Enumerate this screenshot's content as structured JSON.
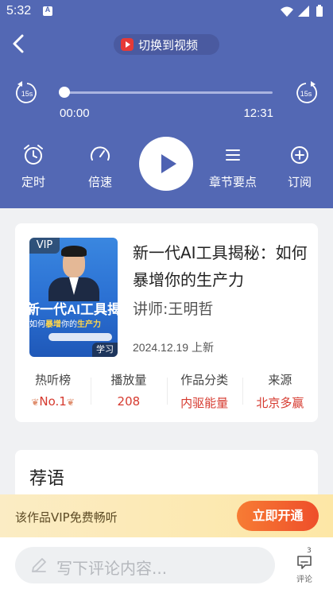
{
  "status_bar": {
    "time": "5:32",
    "notif_letter": "A"
  },
  "player": {
    "switch_label": "切换到视频",
    "skip_back_label": "15s",
    "skip_fwd_label": "15s",
    "current_time": "00:00",
    "total_time": "12:31",
    "progress": 0,
    "controls": [
      "定时",
      "倍速",
      "章节要点",
      "订阅"
    ]
  },
  "album": {
    "cover": {
      "vip": "VIP",
      "headline": "新一代AI工具揭",
      "sub_prefix": "如何",
      "sub_highlight1": "暴增",
      "sub_mid": "你的",
      "sub_highlight2": "生产力",
      "tag": "学习"
    },
    "title": "新一代AI工具揭秘：如何暴增你的生产力",
    "lecturer": "讲师:王明哲",
    "date": "2024.12.19 上新",
    "stats": [
      {
        "key": "热听榜",
        "value": "No.1"
      },
      {
        "key": "播放量",
        "value": "208"
      },
      {
        "key": "作品分类",
        "value": "内驱能量"
      },
      {
        "key": "来源",
        "value": "北京多赢"
      }
    ]
  },
  "recommend": {
    "heading": "荐语"
  },
  "vip_bar": {
    "text": "该作品VIP免费畅听",
    "button": "立即开通"
  },
  "comment": {
    "placeholder": "写下评论内容...",
    "count": "3",
    "label": "评论"
  },
  "colors": {
    "player_bg": "#5368b4",
    "accent_red": "#d63a2f",
    "vip_btn": "#ee4e2a"
  }
}
